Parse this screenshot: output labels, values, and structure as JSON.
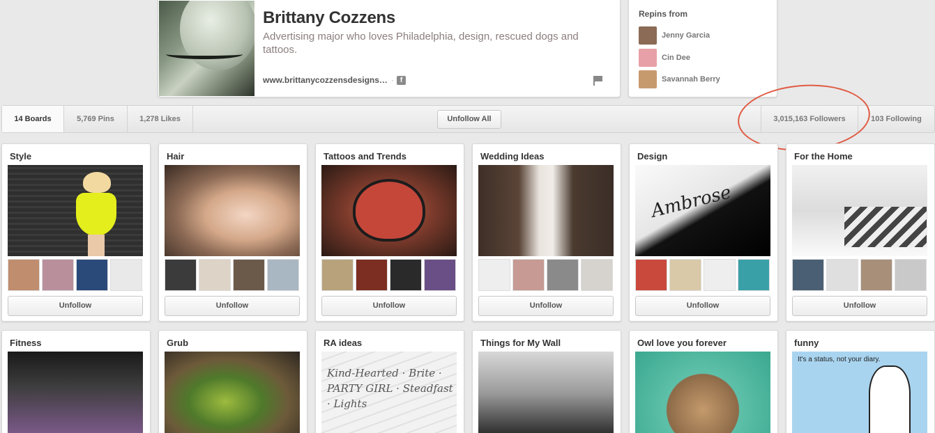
{
  "profile": {
    "name": "Brittany Cozzens",
    "bio": "Advertising major who loves Philadelphia, design, rescued dogs and tattoos.",
    "website": "www.brittanycozzensdesigns…",
    "separator": "·",
    "facebook_glyph": "f"
  },
  "repins": {
    "title": "Repins from",
    "people": [
      {
        "name": "Jenny Garcia",
        "color": "#8b6b55"
      },
      {
        "name": "Cin Dee",
        "color": "#e8a0a8"
      },
      {
        "name": "Savannah Berry",
        "color": "#c79a6e"
      }
    ]
  },
  "stats": {
    "boards": "14 Boards",
    "pins": "5,769 Pins",
    "likes": "1,278 Likes",
    "unfollow_all": "Unfollow All",
    "followers": "3,015,163 Followers",
    "following": "103 Following"
  },
  "boards": [
    {
      "title": "Style",
      "unfollow": "Unfollow",
      "smalls": [
        "#c08d6e",
        "#b98f9c",
        "#2a4a7a",
        "#e9e9e9"
      ]
    },
    {
      "title": "Hair",
      "unfollow": "Unfollow",
      "smalls": [
        "#3b3b3b",
        "#ddd3c7",
        "#6b5a4a",
        "#a9b7c2"
      ]
    },
    {
      "title": "Tattoos and Trends",
      "unfollow": "Unfollow",
      "smalls": [
        "#b7a27c",
        "#7c2e22",
        "#2a2a2a",
        "#6a4f86"
      ]
    },
    {
      "title": "Wedding Ideas",
      "unfollow": "Unfollow",
      "smalls": [
        "#eeeeee",
        "#c79a94",
        "#8a8a8a",
        "#d6d3cf"
      ]
    },
    {
      "title": "Design",
      "unfollow": "Unfollow",
      "smalls": [
        "#c94a3d",
        "#d9c9a8",
        "#eeeeee",
        "#3aa0a8"
      ]
    },
    {
      "title": "For the Home",
      "unfollow": "Unfollow",
      "smalls": [
        "#4a5f73",
        "#dfdfdf",
        "#a88f7a",
        "#c9c9c9"
      ]
    },
    {
      "title": "Fitness"
    },
    {
      "title": "Grub"
    },
    {
      "title": "RA ideas",
      "cover_text": "Kind-Hearted · Brite · PARTY GIRL · Steadfast · Lights"
    },
    {
      "title": "Things for My Wall"
    },
    {
      "title": "Owl love you forever"
    },
    {
      "title": "funny",
      "cover_text": "It's a status, not your diary."
    }
  ]
}
